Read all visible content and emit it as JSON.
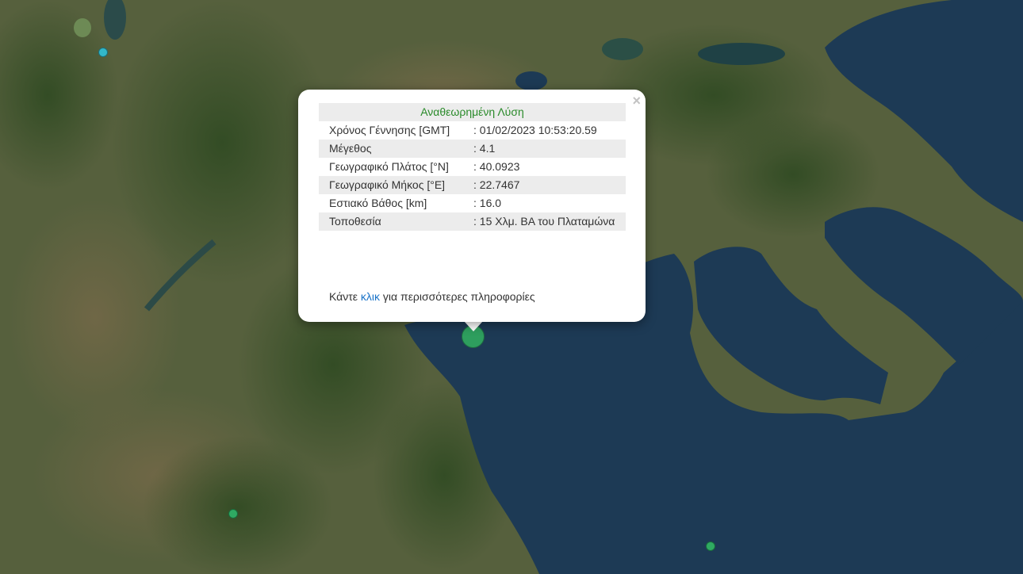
{
  "map": {
    "water_color": "#1d3a55",
    "land_color": "#4e5a36"
  },
  "popup": {
    "header": "Αναθεωρημένη Λύση",
    "header_color": "#2a8a2a",
    "close_symbol": "×",
    "rows": [
      {
        "label": "Χρόνος Γέννησης [GMT]",
        "value": ": 01/02/2023 10:53:20.59"
      },
      {
        "label": "Μέγεθος",
        "value": ": 4.1"
      },
      {
        "label": "Γεωγραφικό Πλάτος [°N]",
        "value": ": 40.0923"
      },
      {
        "label": "Γεωγραφικό Μήκος [°E]",
        "value": ": 22.7467"
      },
      {
        "label": "Εστιακό Βάθος [km]",
        "value": ": 16.0"
      },
      {
        "label": "Τοποθεσία",
        "value": ": 15 Χλμ. ΒΑ του Πλαταμώνα"
      }
    ],
    "more_prefix": "Κάντε ",
    "more_link": "κλικ",
    "more_suffix": " για περισσότερες πληροφορίες"
  },
  "markers": [
    {
      "name": "selected-earthquake-marker",
      "color": "#2e9e5e"
    },
    {
      "name": "earthquake-marker-cyan",
      "color": "#32b7c9"
    },
    {
      "name": "earthquake-marker-green",
      "color": "#2faa62"
    },
    {
      "name": "earthquake-marker-green",
      "color": "#2faa62"
    }
  ]
}
